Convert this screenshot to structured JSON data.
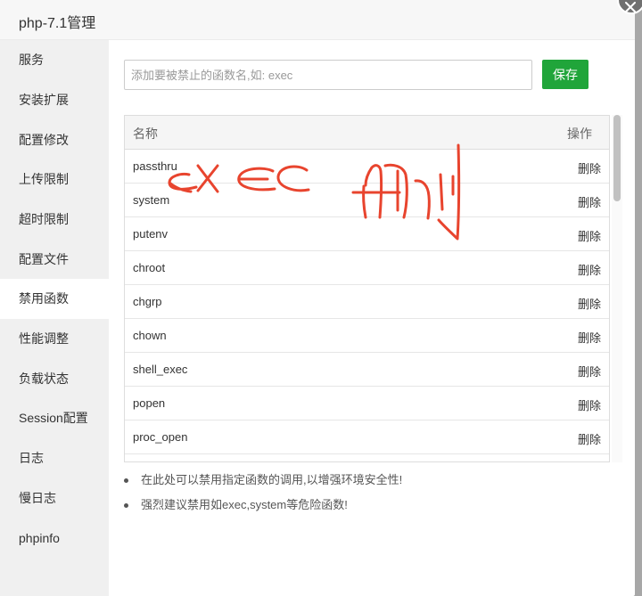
{
  "dialog": {
    "title": "php-7.1管理"
  },
  "sidebar": {
    "items": [
      {
        "label": "服务"
      },
      {
        "label": "安装扩展"
      },
      {
        "label": "配置修改"
      },
      {
        "label": "上传限制"
      },
      {
        "label": "超时限制"
      },
      {
        "label": "配置文件"
      },
      {
        "label": "禁用函数",
        "active": true
      },
      {
        "label": "性能调整"
      },
      {
        "label": "负载状态"
      },
      {
        "label": "Session配置"
      },
      {
        "label": "日志"
      },
      {
        "label": "慢日志"
      },
      {
        "label": "phpinfo"
      }
    ]
  },
  "form": {
    "placeholder": "添加要被禁止的函数名,如: exec",
    "value": "",
    "save_label": "保存"
  },
  "table": {
    "headers": {
      "name": "名称",
      "op": "操作"
    },
    "rows": [
      {
        "name": "passthru",
        "action": "删除"
      },
      {
        "name": "system",
        "action": "删除"
      },
      {
        "name": "putenv",
        "action": "删除"
      },
      {
        "name": "chroot",
        "action": "删除"
      },
      {
        "name": "chgrp",
        "action": "删除"
      },
      {
        "name": "chown",
        "action": "删除"
      },
      {
        "name": "shell_exec",
        "action": "删除"
      },
      {
        "name": "popen",
        "action": "删除"
      },
      {
        "name": "proc_open",
        "action": "删除"
      }
    ]
  },
  "tips": [
    "在此处可以禁用指定函数的调用,以增强环境安全性!",
    "强烈建议禁用如exec,system等危险函数!"
  ],
  "colors": {
    "accent": "#20a53a",
    "sidebar_bg": "#f0f0f0",
    "annotation": "#e8442e"
  }
}
